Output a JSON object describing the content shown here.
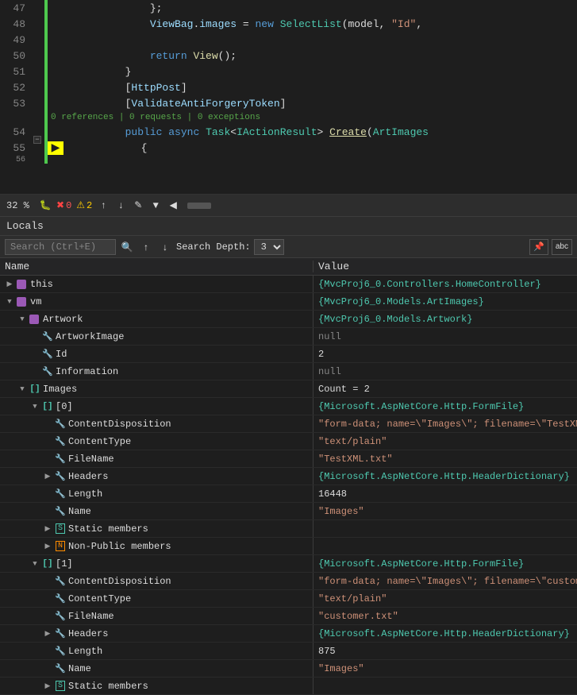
{
  "editor": {
    "lines": [
      {
        "num": "47",
        "indent": "                ",
        "content": [
          {
            "t": "text",
            "v": "};"
          }
        ]
      },
      {
        "num": "48",
        "indent": "                ",
        "content": [
          {
            "t": "attr",
            "v": "ViewBag"
          },
          {
            "t": "text",
            "v": "."
          },
          {
            "t": "attr",
            "v": "images"
          },
          {
            "t": "text",
            "v": " = "
          },
          {
            "t": "kw",
            "v": "new"
          },
          {
            "t": "text",
            "v": " "
          },
          {
            "t": "type",
            "v": "SelectList"
          },
          {
            "t": "text",
            "v": "(model, "
          },
          {
            "t": "str",
            "v": "\"Id\""
          },
          {
            "t": "text",
            "v": ","
          }
        ]
      },
      {
        "num": "49",
        "indent": "",
        "content": []
      },
      {
        "num": "50",
        "indent": "                ",
        "content": [
          {
            "t": "kw",
            "v": "return"
          },
          {
            "t": "text",
            "v": " "
          },
          {
            "t": "method",
            "v": "View"
          },
          {
            "t": "text",
            "v": "();"
          }
        ]
      },
      {
        "num": "51",
        "indent": "            ",
        "content": [
          {
            "t": "text",
            "v": "}"
          }
        ]
      },
      {
        "num": "52",
        "indent": "            ",
        "content": [
          {
            "t": "text",
            "v": "["
          },
          {
            "t": "attr",
            "v": "HttpPost"
          },
          {
            "t": "text",
            "v": "]"
          }
        ]
      },
      {
        "num": "53",
        "indent": "            ",
        "content": [
          {
            "t": "text",
            "v": "["
          },
          {
            "t": "attr",
            "v": "ValidateAntiForgeryToken"
          },
          {
            "t": "text",
            "v": "]"
          }
        ]
      },
      {
        "num": "53_ref",
        "indent": "",
        "content": [
          {
            "t": "ref",
            "v": "0 references | 0 requests | 0 exceptions"
          }
        ]
      },
      {
        "num": "54",
        "indent": "            ",
        "content": [
          {
            "t": "kw",
            "v": "public"
          },
          {
            "t": "text",
            "v": " "
          },
          {
            "t": "kw",
            "v": "async"
          },
          {
            "t": "text",
            "v": " "
          },
          {
            "t": "type",
            "v": "Task"
          },
          {
            "t": "text",
            "v": "<"
          },
          {
            "t": "type",
            "v": "IActionResult"
          },
          {
            "t": "text",
            "v": "> "
          },
          {
            "t": "method",
            "v": "Create"
          },
          {
            "t": "text",
            "v": "("
          },
          {
            "t": "type",
            "v": "ArtImages"
          }
        ]
      },
      {
        "num": "55",
        "indent": "            ",
        "content": [
          {
            "t": "text",
            "v": "{"
          }
        ]
      }
    ]
  },
  "toolbar": {
    "zoom": "32 %",
    "error_count": "0",
    "warning_count": "2"
  },
  "locals": {
    "panel_title": "Locals",
    "search_placeholder": "Search (Ctrl+E)",
    "search_depth_label": "Search Depth:",
    "search_depth_value": "3",
    "col_name": "Name",
    "col_value": "Value",
    "rows": [
      {
        "id": "this",
        "indent": 0,
        "expand": "collapsed",
        "icon": "obj",
        "name": "this",
        "value": "{MvcProj6_0.Controllers.HomeController}",
        "value_color": "cyan"
      },
      {
        "id": "vm",
        "indent": 0,
        "expand": "expanded",
        "icon": "obj",
        "name": "vm",
        "value": "{MvcProj6_0.Models.ArtImages}",
        "value_color": "cyan"
      },
      {
        "id": "artwork",
        "indent": 1,
        "expand": "expanded",
        "icon": "obj",
        "name": "Artwork",
        "value": "{MvcProj6_0.Models.Artwork}",
        "value_color": "cyan"
      },
      {
        "id": "artworkimage",
        "indent": 2,
        "expand": "leaf",
        "icon": "wrench",
        "name": "ArtworkImage",
        "value": "null",
        "value_color": "gray"
      },
      {
        "id": "id",
        "indent": 2,
        "expand": "leaf",
        "icon": "wrench",
        "name": "Id",
        "value": "2",
        "value_color": "white"
      },
      {
        "id": "information",
        "indent": 2,
        "expand": "leaf",
        "icon": "wrench",
        "name": "Information",
        "value": "null",
        "value_color": "gray"
      },
      {
        "id": "images",
        "indent": 1,
        "expand": "expanded",
        "icon": "array",
        "name": "Images",
        "value": "Count = 2",
        "value_color": "white"
      },
      {
        "id": "idx0",
        "indent": 2,
        "expand": "expanded",
        "icon": "array_item",
        "name": "[0]",
        "value": "{Microsoft.AspNetCore.Http.FormFile}",
        "value_color": "cyan"
      },
      {
        "id": "contentdisposition0",
        "indent": 3,
        "expand": "leaf",
        "icon": "wrench",
        "name": "ContentDisposition",
        "value": "\"form-data; name=\\\"Images\\\"; filename=\\\"TestXML.txt\\\"\"",
        "value_color": "orange"
      },
      {
        "id": "contenttype0",
        "indent": 3,
        "expand": "leaf",
        "icon": "wrench",
        "name": "ContentType",
        "value": "\"text/plain\"",
        "value_color": "orange"
      },
      {
        "id": "filename0",
        "indent": 3,
        "expand": "leaf",
        "icon": "wrench",
        "name": "FileName",
        "value": "\"TestXML.txt\"",
        "value_color": "orange"
      },
      {
        "id": "headers0",
        "indent": 3,
        "expand": "collapsed",
        "icon": "wrench",
        "name": "Headers",
        "value": "{Microsoft.AspNetCore.Http.HeaderDictionary}",
        "value_color": "cyan"
      },
      {
        "id": "length0",
        "indent": 3,
        "expand": "leaf",
        "icon": "wrench",
        "name": "Length",
        "value": "16448",
        "value_color": "white"
      },
      {
        "id": "name0",
        "indent": 3,
        "expand": "leaf",
        "icon": "wrench",
        "name": "Name",
        "value": "\"Images\"",
        "value_color": "orange"
      },
      {
        "id": "static0",
        "indent": 3,
        "expand": "collapsed",
        "icon": "static",
        "name": "Static members",
        "value": "",
        "value_color": "white"
      },
      {
        "id": "nonpublic0",
        "indent": 3,
        "expand": "collapsed",
        "icon": "nonpublic",
        "name": "Non-Public members",
        "value": "",
        "value_color": "white"
      },
      {
        "id": "idx1",
        "indent": 2,
        "expand": "expanded",
        "icon": "array_item",
        "name": "[1]",
        "value": "{Microsoft.AspNetCore.Http.FormFile}",
        "value_color": "cyan"
      },
      {
        "id": "contentdisposition1",
        "indent": 3,
        "expand": "leaf",
        "icon": "wrench",
        "name": "ContentDisposition",
        "value": "\"form-data; name=\\\"Images\\\"; filename=\\\"customer.txt\\\"\"",
        "value_color": "orange"
      },
      {
        "id": "contenttype1",
        "indent": 3,
        "expand": "leaf",
        "icon": "wrench",
        "name": "ContentType",
        "value": "\"text/plain\"",
        "value_color": "orange"
      },
      {
        "id": "filename1",
        "indent": 3,
        "expand": "leaf",
        "icon": "wrench",
        "name": "FileName",
        "value": "\"customer.txt\"",
        "value_color": "orange"
      },
      {
        "id": "headers1",
        "indent": 3,
        "expand": "collapsed",
        "icon": "wrench",
        "name": "Headers",
        "value": "{Microsoft.AspNetCore.Http.HeaderDictionary}",
        "value_color": "cyan"
      },
      {
        "id": "length1",
        "indent": 3,
        "expand": "leaf",
        "icon": "wrench",
        "name": "Length",
        "value": "875",
        "value_color": "white"
      },
      {
        "id": "name1",
        "indent": 3,
        "expand": "leaf",
        "icon": "wrench",
        "name": "Name",
        "value": "\"Images\"",
        "value_color": "orange"
      },
      {
        "id": "static1",
        "indent": 3,
        "expand": "collapsed",
        "icon": "static",
        "name": "Static members",
        "value": "",
        "value_color": "white"
      }
    ]
  }
}
